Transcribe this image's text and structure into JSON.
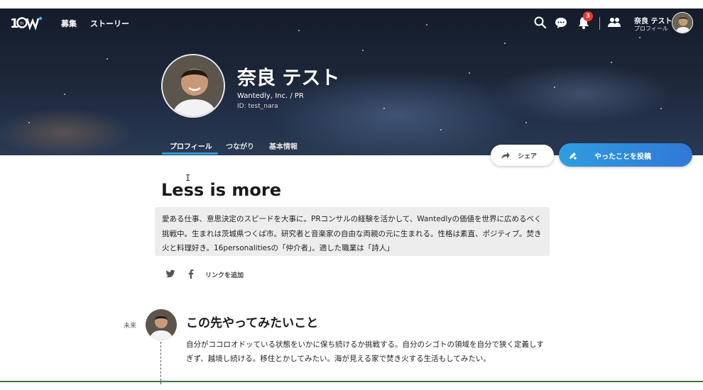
{
  "header": {
    "logo_text": "16W",
    "nav": [
      "募集",
      "ストーリー"
    ],
    "icons": [
      "search-icon",
      "chat-icon",
      "bell-icon",
      "people-icon"
    ],
    "notification_count": "3",
    "user_name": "奈良 テスト",
    "user_sub": "プロフィール"
  },
  "profile": {
    "name": "奈良 テスト",
    "company": "Wantedly, Inc. / PR",
    "id": "ID: test_nara"
  },
  "tabs": [
    "プロフィール",
    "つながり",
    "基本情報"
  ],
  "actions": {
    "share_label": "シェア",
    "post_label": "やったことを投稿"
  },
  "main": {
    "headline": "Less is more",
    "bio": "愛ある仕事、意思決定のスピードを大事に。PRコンサルの経験を活かして、Wantedlyの価値を世界に広めるべく挑戦中。生まれは茨城県つくば市。研究者と音楽家の自由な両親の元に生まれる。性格は素直、ポジティブ。焚き火と料理好き。16personalitiesの「仲介者」。適した職業は「詩人」",
    "add_link_label": "リンクを追加"
  },
  "future": {
    "label": "未来",
    "title": "この先やってみたいこと",
    "body": "自分がココロオドッている状態をいかに保ち続けるか挑戦する。自分のシゴトの領域を自分で狭く定義しすぎず、越境し続ける。移住とかしてみたい。海が見える家で焚き火する生活もしてみたい。"
  },
  "colors": {
    "accent": "#2f9bd8",
    "post_button": "#3178d6",
    "badge": "#e53935"
  }
}
